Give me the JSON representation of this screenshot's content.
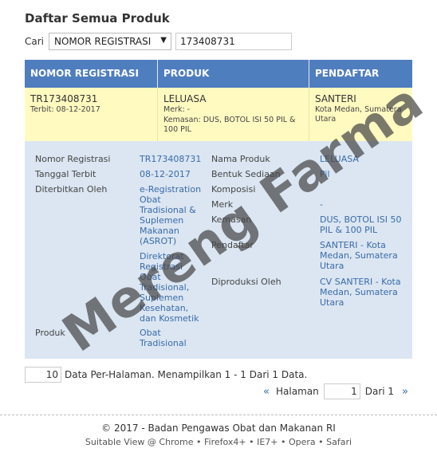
{
  "page": {
    "title": "Daftar Semua Produk"
  },
  "search": {
    "label": "Cari",
    "field_selected": "NOMOR REGISTRASI",
    "query": "173408731"
  },
  "table": {
    "headers": [
      "NOMOR REGISTRASI",
      "PRODUK",
      "PENDAFTAR"
    ],
    "row": {
      "nomor": "TR173408731",
      "terbit": "Terbit: 08-12-2017",
      "produk": "LELUASA",
      "merk": "Merk: -",
      "kemasan": "Kemasan: DUS, BOTOL ISI 50 PIL & 100 PIL",
      "pendaftar": "SANTERI",
      "pendaftar_lokasi": "Kota Medan, Sumatera Utara"
    }
  },
  "detail": {
    "nomor_registrasi_label": "Nomor Registrasi",
    "nomor_registrasi": "TR173408731",
    "tanggal_terbit_label": "Tanggal Terbit",
    "tanggal_terbit": "08-12-2017",
    "diterbitkan_oleh_label": "Diterbitkan Oleh",
    "diterbitkan_oleh_1": "e-Registration Obat Tradisional & Suplemen Makanan (ASROT)",
    "diterbitkan_oleh_2": "Direktorat Registrasi Obat Tradisional, Suplemen Kesehatan, dan Kosmetik",
    "produk_label": "Produk",
    "produk": "Obat Tradisional",
    "nama_produk_label": "Nama Produk",
    "nama_produk": "LELUASA",
    "bentuk_sediaan_label": "Bentuk Sediaan",
    "bentuk_sediaan": "Pil",
    "komposisi_label": "Komposisi",
    "komposisi": "",
    "merk_label": "Merk",
    "merk": "-",
    "kemasan_label": "Kemasan",
    "kemasan": "DUS, BOTOL ISI 50 PIL & 100 PIL",
    "pendaftar_label": "Pendaftar",
    "pendaftar": "SANTERI - Kota Medan, Sumatera Utara",
    "diproduksi_oleh_label": "Diproduksi Oleh",
    "diproduksi_oleh": "CV SANTERI - Kota Medan, Sumatera Utara"
  },
  "pagination": {
    "per_page": "10",
    "summary": "Data Per-Halaman. Menampilkan 1 - 1 Dari 1 Data.",
    "prev": "«",
    "halaman_label": "Halaman",
    "current_page": "1",
    "of_text": "Dari 1",
    "next": "»"
  },
  "footer": {
    "copyright": "© 2017 - Badan Pengawas Obat dan Makanan RI",
    "browsers": "Suitable View @ Chrome • Firefox4+ • IE7+ • Opera • Safari"
  },
  "watermark": {
    "text": "Mereng Farma"
  }
}
